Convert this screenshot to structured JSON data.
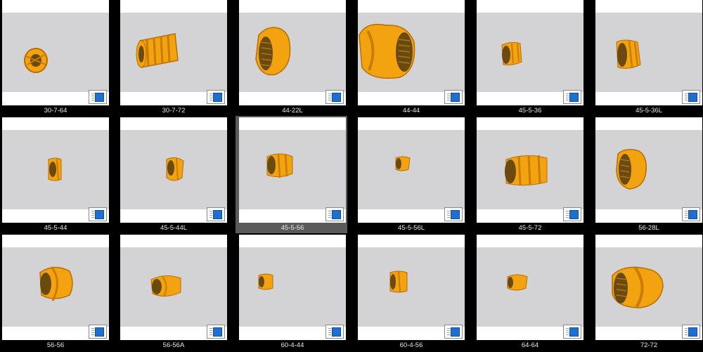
{
  "thumbnails": [
    {
      "label": "30-7-64"
    },
    {
      "label": "30-7-72"
    },
    {
      "label": "44-22L"
    },
    {
      "label": "44-44"
    },
    {
      "label": "45-5-36"
    },
    {
      "label": "45-5-36L"
    },
    {
      "label": "45-5-44"
    },
    {
      "label": "45-5-44L"
    },
    {
      "label": "45-5-56"
    },
    {
      "label": "45-5-56L"
    },
    {
      "label": "45-5-72"
    },
    {
      "label": "56-28L"
    },
    {
      "label": "56-56"
    },
    {
      "label": "56-56A"
    },
    {
      "label": "60-4-44"
    },
    {
      "label": "60-4-56"
    },
    {
      "label": "64-64"
    },
    {
      "label": "72-72"
    }
  ],
  "selected_label": "45-5-56",
  "colors": {
    "background": "#000000",
    "viewport": "#d3d3d5",
    "part": "#f2a30f",
    "selection": "#5a5a5a",
    "badge_screen": "#1f6fd1"
  },
  "icons": {
    "badge": "file-type-icon",
    "part": "screw-element-icon"
  }
}
